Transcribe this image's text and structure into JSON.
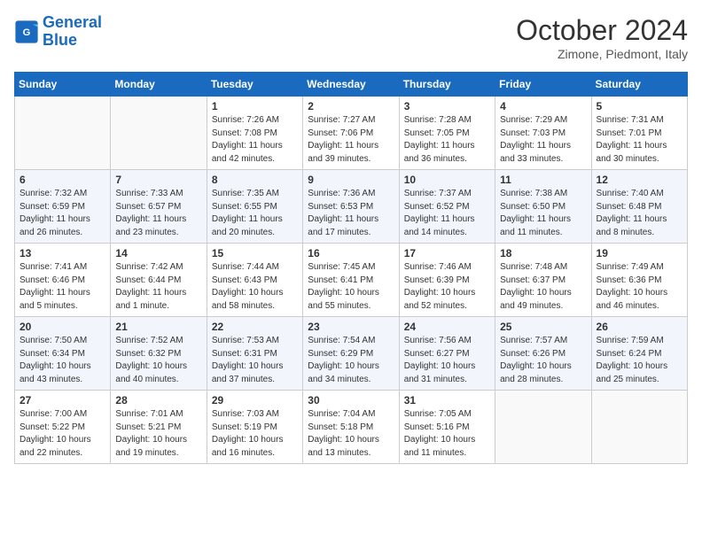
{
  "header": {
    "logo_line1": "General",
    "logo_line2": "Blue",
    "month_title": "October 2024",
    "subtitle": "Zimone, Piedmont, Italy"
  },
  "days_of_week": [
    "Sunday",
    "Monday",
    "Tuesday",
    "Wednesday",
    "Thursday",
    "Friday",
    "Saturday"
  ],
  "weeks": [
    [
      {
        "day": "",
        "info": ""
      },
      {
        "day": "",
        "info": ""
      },
      {
        "day": "1",
        "info": "Sunrise: 7:26 AM\nSunset: 7:08 PM\nDaylight: 11 hours and 42 minutes."
      },
      {
        "day": "2",
        "info": "Sunrise: 7:27 AM\nSunset: 7:06 PM\nDaylight: 11 hours and 39 minutes."
      },
      {
        "day": "3",
        "info": "Sunrise: 7:28 AM\nSunset: 7:05 PM\nDaylight: 11 hours and 36 minutes."
      },
      {
        "day": "4",
        "info": "Sunrise: 7:29 AM\nSunset: 7:03 PM\nDaylight: 11 hours and 33 minutes."
      },
      {
        "day": "5",
        "info": "Sunrise: 7:31 AM\nSunset: 7:01 PM\nDaylight: 11 hours and 30 minutes."
      }
    ],
    [
      {
        "day": "6",
        "info": "Sunrise: 7:32 AM\nSunset: 6:59 PM\nDaylight: 11 hours and 26 minutes."
      },
      {
        "day": "7",
        "info": "Sunrise: 7:33 AM\nSunset: 6:57 PM\nDaylight: 11 hours and 23 minutes."
      },
      {
        "day": "8",
        "info": "Sunrise: 7:35 AM\nSunset: 6:55 PM\nDaylight: 11 hours and 20 minutes."
      },
      {
        "day": "9",
        "info": "Sunrise: 7:36 AM\nSunset: 6:53 PM\nDaylight: 11 hours and 17 minutes."
      },
      {
        "day": "10",
        "info": "Sunrise: 7:37 AM\nSunset: 6:52 PM\nDaylight: 11 hours and 14 minutes."
      },
      {
        "day": "11",
        "info": "Sunrise: 7:38 AM\nSunset: 6:50 PM\nDaylight: 11 hours and 11 minutes."
      },
      {
        "day": "12",
        "info": "Sunrise: 7:40 AM\nSunset: 6:48 PM\nDaylight: 11 hours and 8 minutes."
      }
    ],
    [
      {
        "day": "13",
        "info": "Sunrise: 7:41 AM\nSunset: 6:46 PM\nDaylight: 11 hours and 5 minutes."
      },
      {
        "day": "14",
        "info": "Sunrise: 7:42 AM\nSunset: 6:44 PM\nDaylight: 11 hours and 1 minute."
      },
      {
        "day": "15",
        "info": "Sunrise: 7:44 AM\nSunset: 6:43 PM\nDaylight: 10 hours and 58 minutes."
      },
      {
        "day": "16",
        "info": "Sunrise: 7:45 AM\nSunset: 6:41 PM\nDaylight: 10 hours and 55 minutes."
      },
      {
        "day": "17",
        "info": "Sunrise: 7:46 AM\nSunset: 6:39 PM\nDaylight: 10 hours and 52 minutes."
      },
      {
        "day": "18",
        "info": "Sunrise: 7:48 AM\nSunset: 6:37 PM\nDaylight: 10 hours and 49 minutes."
      },
      {
        "day": "19",
        "info": "Sunrise: 7:49 AM\nSunset: 6:36 PM\nDaylight: 10 hours and 46 minutes."
      }
    ],
    [
      {
        "day": "20",
        "info": "Sunrise: 7:50 AM\nSunset: 6:34 PM\nDaylight: 10 hours and 43 minutes."
      },
      {
        "day": "21",
        "info": "Sunrise: 7:52 AM\nSunset: 6:32 PM\nDaylight: 10 hours and 40 minutes."
      },
      {
        "day": "22",
        "info": "Sunrise: 7:53 AM\nSunset: 6:31 PM\nDaylight: 10 hours and 37 minutes."
      },
      {
        "day": "23",
        "info": "Sunrise: 7:54 AM\nSunset: 6:29 PM\nDaylight: 10 hours and 34 minutes."
      },
      {
        "day": "24",
        "info": "Sunrise: 7:56 AM\nSunset: 6:27 PM\nDaylight: 10 hours and 31 minutes."
      },
      {
        "day": "25",
        "info": "Sunrise: 7:57 AM\nSunset: 6:26 PM\nDaylight: 10 hours and 28 minutes."
      },
      {
        "day": "26",
        "info": "Sunrise: 7:59 AM\nSunset: 6:24 PM\nDaylight: 10 hours and 25 minutes."
      }
    ],
    [
      {
        "day": "27",
        "info": "Sunrise: 7:00 AM\nSunset: 5:22 PM\nDaylight: 10 hours and 22 minutes."
      },
      {
        "day": "28",
        "info": "Sunrise: 7:01 AM\nSunset: 5:21 PM\nDaylight: 10 hours and 19 minutes."
      },
      {
        "day": "29",
        "info": "Sunrise: 7:03 AM\nSunset: 5:19 PM\nDaylight: 10 hours and 16 minutes."
      },
      {
        "day": "30",
        "info": "Sunrise: 7:04 AM\nSunset: 5:18 PM\nDaylight: 10 hours and 13 minutes."
      },
      {
        "day": "31",
        "info": "Sunrise: 7:05 AM\nSunset: 5:16 PM\nDaylight: 10 hours and 11 minutes."
      },
      {
        "day": "",
        "info": ""
      },
      {
        "day": "",
        "info": ""
      }
    ]
  ]
}
